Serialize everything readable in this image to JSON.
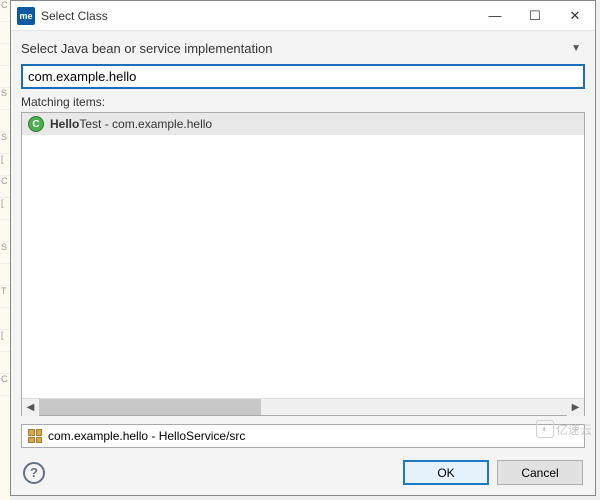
{
  "window": {
    "app_icon_text": "me",
    "title": "Select Class",
    "minimize": "—",
    "maximize": "☐",
    "close": "✕"
  },
  "header": {
    "label": "Select Java bean or service implementation",
    "dropdown_arrow": "▼"
  },
  "search": {
    "value": "com.example.hello"
  },
  "matching": {
    "label": "Matching items:",
    "items": [
      {
        "icon": "C",
        "name_bold": "Hello",
        "name_rest": "Test",
        "location": " - com.example.hello"
      }
    ]
  },
  "scrollbar": {
    "left": "◀",
    "right": "▶"
  },
  "path": {
    "text": "com.example.hello - HelloService/src"
  },
  "footer": {
    "help": "?",
    "ok": "OK",
    "cancel": "Cancel"
  },
  "watermark": {
    "text": "亿速云"
  }
}
